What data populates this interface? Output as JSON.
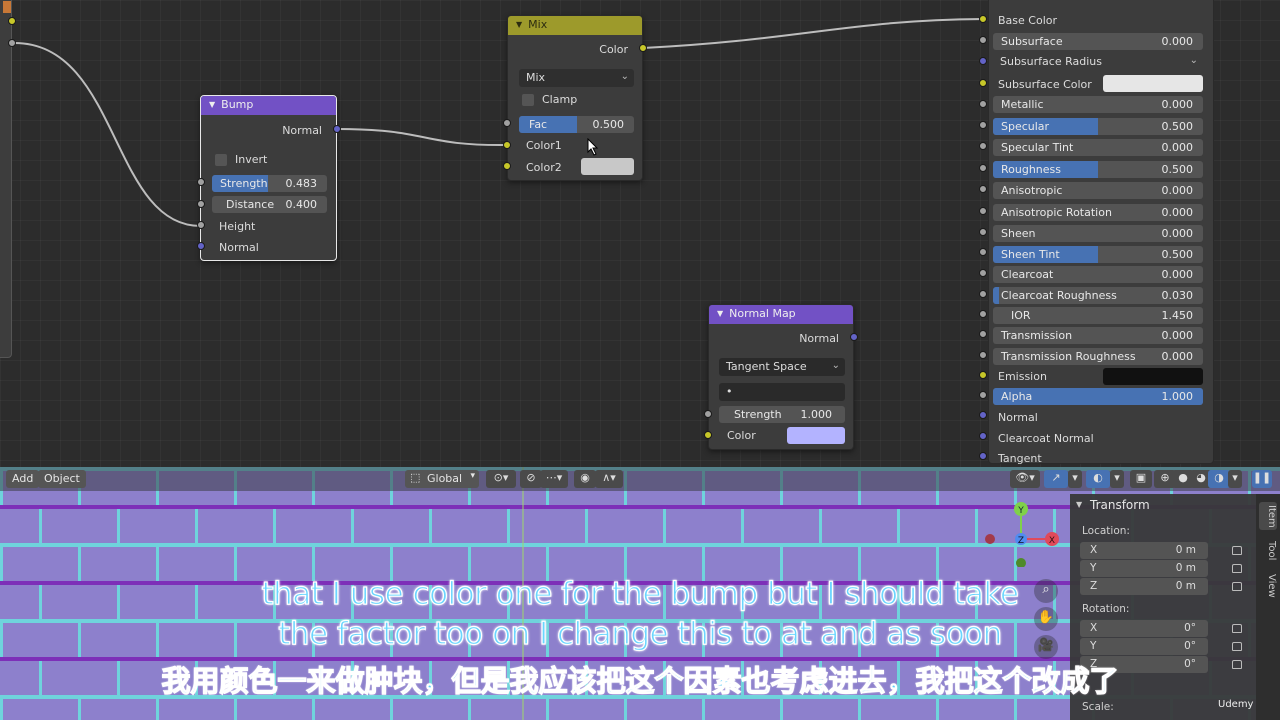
{
  "colors": {
    "node_header_purple": "#7251c5",
    "node_header_yellow": "#9d9a2b",
    "field_fill_blue": "#4772b3",
    "socket_gray": "#a1a1a1",
    "socket_yellow": "#c7c729",
    "socket_purple": "#6363c7",
    "viewport_brick": "#8d80cc",
    "subtitle": "#6ad6ff"
  },
  "nodes": {
    "bump": {
      "title": "Bump",
      "output": "Normal",
      "invert_label": "Invert",
      "strength_label": "Strength",
      "strength_value": "0.483",
      "strength_fraction": 0.483,
      "distance_label": "Distance",
      "distance_value": "0.400",
      "height_label": "Height",
      "normal_label": "Normal"
    },
    "mix": {
      "title": "Mix",
      "output": "Color",
      "blend_mode": "Mix",
      "clamp_label": "Clamp",
      "fac_label": "Fac",
      "fac_value": "0.500",
      "fac_fraction": 0.5,
      "color1_label": "Color1",
      "color2_label": "Color2"
    },
    "normal_map": {
      "title": "Normal Map",
      "output": "Normal",
      "space": "Tangent Space",
      "uv_value": "•",
      "strength_label": "Strength",
      "strength_value": "1.000",
      "color_label": "Color"
    }
  },
  "principled": {
    "base_color": "Base Color",
    "subsurface": {
      "label": "Subsurface",
      "value": "0.000"
    },
    "subsurface_radius": "Subsurface Radius",
    "subsurface_color": "Subsurface Color",
    "metallic": {
      "label": "Metallic",
      "value": "0.000"
    },
    "specular": {
      "label": "Specular",
      "value": "0.500"
    },
    "specular_tint": {
      "label": "Specular Tint",
      "value": "0.000"
    },
    "roughness": {
      "label": "Roughness",
      "value": "0.500"
    },
    "anisotropic": {
      "label": "Anisotropic",
      "value": "0.000"
    },
    "anisotropic_rotation": {
      "label": "Anisotropic Rotation",
      "value": "0.000"
    },
    "sheen": {
      "label": "Sheen",
      "value": "0.000"
    },
    "sheen_tint": {
      "label": "Sheen Tint",
      "value": "0.500"
    },
    "clearcoat": {
      "label": "Clearcoat",
      "value": "0.000"
    },
    "clearcoat_roughness": {
      "label": "Clearcoat Roughness",
      "value": "0.030"
    },
    "ior": {
      "label": "IOR",
      "value": "1.450"
    },
    "transmission": {
      "label": "Transmission",
      "value": "0.000"
    },
    "transmission_roughness": {
      "label": "Transmission Roughness",
      "value": "0.000"
    },
    "emission": "Emission",
    "alpha": {
      "label": "Alpha",
      "value": "1.000"
    },
    "normal": "Normal",
    "clearcoat_normal": "Clearcoat Normal",
    "tangent": "Tangent"
  },
  "viewport": {
    "menu_add": "Add",
    "menu_object": "Object",
    "orientation": "Global",
    "n_panel": {
      "title": "Transform",
      "location_label": "Location:",
      "rotation_label": "Rotation:",
      "scale_label": "Scale:",
      "loc_x": {
        "axis": "X",
        "value": "0 m"
      },
      "loc_y": {
        "axis": "Y",
        "value": "0 m"
      },
      "loc_z": {
        "axis": "Z",
        "value": "0 m"
      },
      "rot_x": {
        "axis": "X",
        "value": "0°"
      },
      "rot_y": {
        "axis": "Y",
        "value": "0°"
      },
      "rot_z": {
        "axis": "Z",
        "value": "0°"
      }
    },
    "tabs": [
      "Item",
      "Tool",
      "View"
    ],
    "gizmo": {
      "x": "X",
      "y": "Y",
      "z": "Z"
    }
  },
  "subtitles": {
    "en_line1": "that I use color one for the bump but I should take",
    "en_line2": "the factor too on I change this to at and as soon",
    "zh_line": "我用颜色一来做肿块，但是我应该把这个因素也考虑进去，我把这个改成了"
  },
  "watermark": "Udemy"
}
